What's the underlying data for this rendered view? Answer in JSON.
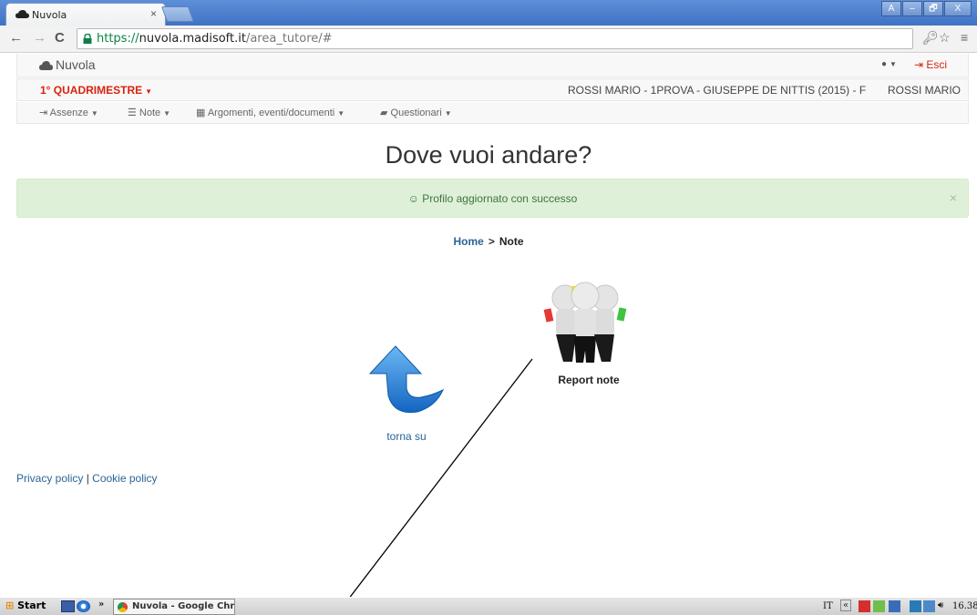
{
  "browser": {
    "tab_title": "Nuvola",
    "tab_close": "×",
    "url_scheme": "https://",
    "url_host": "nuvola.madisoft.it",
    "url_path": "/area_tutore/#",
    "window_buttons": [
      "A",
      "–",
      "🗗",
      "X"
    ]
  },
  "navbar": {
    "brand": "Nuvola",
    "logout": "Esci"
  },
  "periodbar": {
    "period": "1° QUADRIMESTRE",
    "student": "ROSSI MARIO - 1PROVA - GIUSEPPE DE NITTIS (2015) - F",
    "username": "ROSSI MARIO"
  },
  "menu": {
    "items": [
      "Assenze",
      "Note",
      "Argomenti, eventi/documenti",
      "Questionari"
    ]
  },
  "main": {
    "title": "Dove vuoi andare?",
    "alert": "☺ Profilo aggiornato con successo",
    "alert_close": "×",
    "breadcrumb": {
      "home": "Home",
      "separator": ">",
      "current": "Note"
    },
    "tiles": {
      "report_label": "Report note",
      "up_label": "torna su"
    }
  },
  "footer": {
    "privacy": "Privacy policy",
    "separator": "|",
    "cookie": "Cookie policy"
  },
  "taskbar": {
    "start": "Start",
    "overflow": "»",
    "task_label": "Nuvola - Google Chro...",
    "lang": "IT",
    "tray_overflow": "«",
    "clock": "16.38"
  },
  "colors": {
    "accent_red": "#d9230f",
    "link_blue": "#2a6496",
    "alert_bg": "#dff0d8",
    "alert_text": "#3c763d"
  },
  "icons": [
    "cloud-icon",
    "user-icon",
    "logout-icon",
    "lock-icon",
    "star-icon",
    "key-icon",
    "menu-icon",
    "report-note-icon",
    "arrow-up-icon"
  ]
}
